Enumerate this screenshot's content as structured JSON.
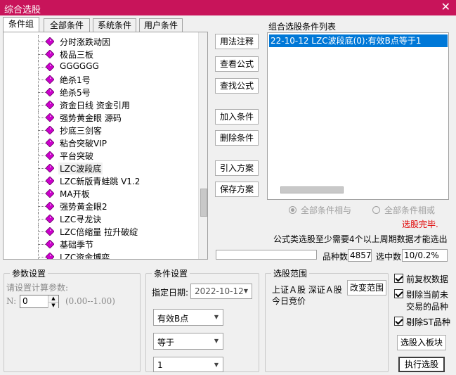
{
  "window": {
    "title": "综合选股",
    "close": "✕"
  },
  "tabs": [
    "条件组",
    "全部条件",
    "系统条件",
    "用户条件"
  ],
  "tree_items": [
    "分时涨跌动因",
    "极品三板",
    "GGGGGG",
    "绝杀1号",
    "绝杀5号",
    "资金日线 资金引用",
    "强势黄金眼 源码",
    "抄底三剑客",
    "粘合突破VIP",
    "平台突破",
    "LZC波段底",
    "LZC新版青蛙跳 V1.2",
    "MA开板",
    "强势黄金眼2",
    "LZC寻龙诀",
    "LZC倍缩量 拉升破绽",
    "基础季节",
    "LZC资金博弈"
  ],
  "tree_selected_index": 10,
  "buttons": {
    "usage": "用法注释",
    "view_formula": "查看公式",
    "find_formula": "查找公式",
    "add_condition": "加入条件",
    "delete_condition": "删除条件",
    "import_scheme": "引入方案",
    "save_scheme": "保存方案",
    "change_range": "改变范围",
    "to_block": "选股入板块",
    "execute": "执行选股"
  },
  "condition_list": {
    "label": "组合选股条件列表",
    "items": [
      "22-10-12 LZC波段底(0):有效B点等于1"
    ]
  },
  "radios": {
    "and": "全部条件相与",
    "or": "全部条件相或"
  },
  "status": "选股完毕.",
  "note": "公式类选股至少需要4个以上周期数据才能选出",
  "stats": {
    "count_label": "品种数",
    "count_value": "4857",
    "selected_label": "选中数",
    "selected_value": "10/0.2%"
  },
  "params": {
    "title": "参数设置",
    "hint": "请设置计算参数:",
    "n_label": "N:",
    "n_value": "0",
    "range": "(0.00--1.00)"
  },
  "conditions": {
    "title": "条件设置",
    "date_label": "指定日期:",
    "date_value": "2022-10-12",
    "field": "有效B点",
    "operator": "等于",
    "value": "1"
  },
  "scope": {
    "title": "选股范围",
    "line1": "上证Ａ股 深证Ａ股",
    "line2": "今日竞价"
  },
  "checks": {
    "forward_adjust": "前复权数据",
    "exclude_untraded_1": "剔除当前未",
    "exclude_untraded_2": "交易的品种",
    "exclude_st": "剔除ST品种"
  },
  "colors": {
    "title_bar": "#c8145a",
    "selection": "#0078d7",
    "status": "#e00000",
    "tree_icon": "#cc00cc"
  }
}
